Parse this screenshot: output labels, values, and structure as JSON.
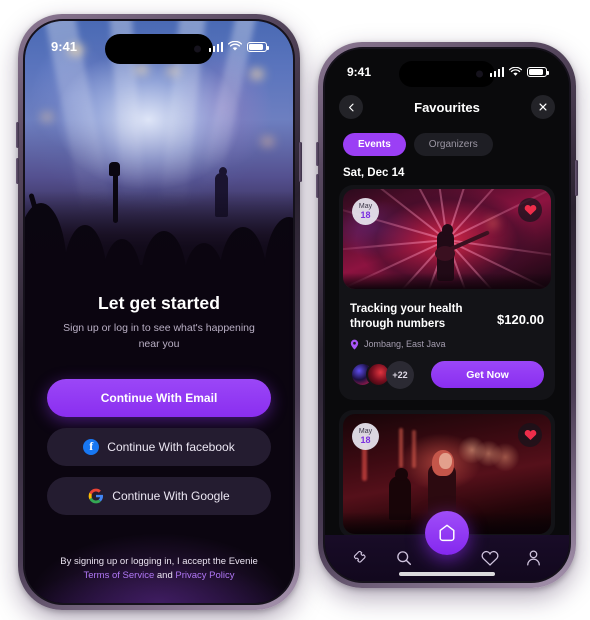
{
  "screen_left": {
    "status": {
      "time": "9:41",
      "signal_icon": "cellular-signal-icon",
      "wifi_icon": "wifi-icon",
      "battery_icon": "battery-icon"
    },
    "hero_image_alt": "concert-crowd-photo",
    "title": "Let get started",
    "subtitle": "Sign up or log in to see what's happening near you",
    "buttons": [
      {
        "label": "Continue With Email",
        "style": "primary",
        "icon": ""
      },
      {
        "label": "Continue With facebook",
        "style": "social",
        "icon": "facebook-icon"
      },
      {
        "label": "Continue With Google",
        "style": "social",
        "icon": "google-icon"
      }
    ],
    "legal": {
      "line1": "By signing up or logging in, I accept the Evenie",
      "terms": "Terms of Service",
      "conjunction": "and",
      "privacy": "Privacy Policy"
    },
    "colors": {
      "accent": "#8a2ef0",
      "link": "#b077f5",
      "background": "#0b0510"
    }
  },
  "screen_right": {
    "status": {
      "time": "9:41",
      "signal_icon": "cellular-signal-icon",
      "wifi_icon": "wifi-icon",
      "battery_icon": "battery-icon"
    },
    "header": {
      "back_icon": "chevron-left-icon",
      "title": "Favourites",
      "close_icon": "close-icon"
    },
    "tabs": [
      {
        "label": "Events",
        "active": true
      },
      {
        "label": "Organizers",
        "active": false
      }
    ],
    "day_label": "Sat, Dec 14",
    "cards": [
      {
        "date_month": "May",
        "date_day": "18",
        "favourite_icon": "heart-filled-icon",
        "image_alt": "guitarist-red-stage-lights-photo",
        "title": "Tracking your health through numbers",
        "price": "$120.00",
        "location_icon": "location-pin-icon",
        "location": "Jombang, East Java",
        "attendees_more": "+22",
        "cta_label": "Get Now"
      },
      {
        "date_month": "May",
        "date_day": "18",
        "favourite_icon": "heart-filled-icon",
        "image_alt": "woman-red-club-lights-photo"
      }
    ],
    "bottom_nav": [
      {
        "icon": "ticket-icon",
        "active": false
      },
      {
        "icon": "search-icon",
        "active": false
      },
      {
        "icon": "home-icon",
        "active": true
      },
      {
        "icon": "heart-outline-icon",
        "active": false
      },
      {
        "icon": "person-icon",
        "active": false
      }
    ],
    "colors": {
      "accent": "#9b3ff5",
      "background": "#0a0a0c",
      "card": "#131317"
    }
  }
}
